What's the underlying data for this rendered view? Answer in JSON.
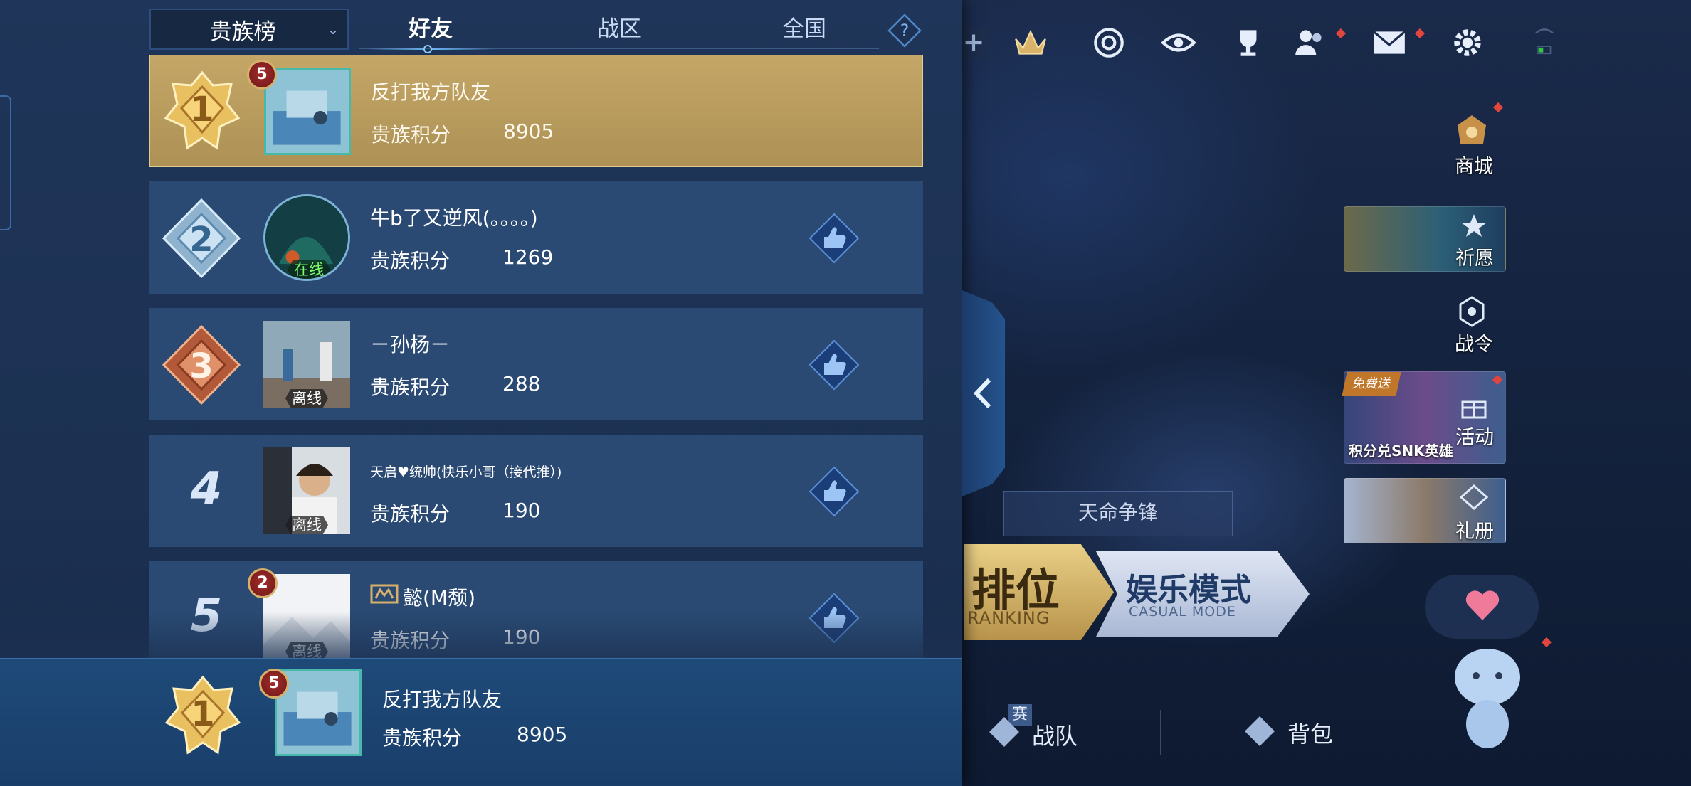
{
  "panel": {
    "dropdown_label": "贵族榜",
    "tabs": [
      "好友",
      "战区",
      "全国"
    ],
    "help_label": "?",
    "score_label": "贵族积分"
  },
  "rows": [
    {
      "rank": "1",
      "name": "反打我方队友",
      "score": "8905",
      "level": "5",
      "status": ""
    },
    {
      "rank": "2",
      "name": "牛b了又逆风(。。。。)",
      "score": "1269",
      "level": "",
      "status": "在线"
    },
    {
      "rank": "3",
      "name": "－孙杨－",
      "score": "288",
      "level": "",
      "status": "离线"
    },
    {
      "rank": "4",
      "name": "天启♥统帅(快乐小哥（接代推）)",
      "score": "190",
      "level": "",
      "status": "离线"
    },
    {
      "rank": "5",
      "name": "懿(M颓)",
      "score": "190",
      "level": "2",
      "status": "离线"
    }
  ],
  "self": {
    "rank": "1",
    "name": "反打我方队友",
    "score": "8905",
    "level": "5"
  },
  "lobby": {
    "side_entries": [
      "商城",
      "祈愿",
      "战令",
      "活动",
      "礼册"
    ],
    "activity_promo": "积分兑SNK英雄",
    "activity_tag": "免费送",
    "event_title": "天命争锋",
    "mode_rank": "排位",
    "mode_rank_en": "RANKING",
    "mode_casual": "娱乐模式",
    "mode_casual_en": "CASUAL MODE",
    "bottom_team": "战队",
    "bottom_team_tag": "赛",
    "bottom_bag": "背包"
  },
  "colors": {
    "panel_bg": "#1f3559",
    "row_bg": "#2a4a73",
    "self_row_gold": "#c4a767",
    "online_green": "#7dff6a",
    "badge_red": "#e0463d"
  }
}
